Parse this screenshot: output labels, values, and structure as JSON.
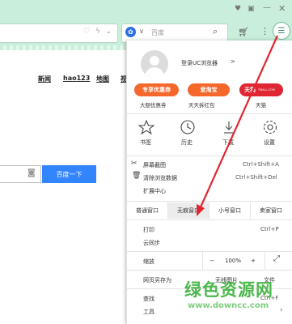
{
  "search": {
    "engine_name": "百度"
  },
  "page_nav": [
    "新闻",
    "hao123",
    "地图",
    "视"
  ],
  "baidu_button": "百度一下",
  "menu": {
    "login": "登录UC浏览器",
    "login_arrow": ">",
    "promos": [
      {
        "badge": "专享优惠券",
        "caption": "大额优惠券",
        "color": "#f5672a"
      },
      {
        "badge": "爱淘宝",
        "caption": "天天拆红包",
        "color": "#f5672a"
      },
      {
        "badge": "天猫",
        "caption": "天猫",
        "color": "#e02533"
      }
    ],
    "tmall_small": "TMALL.COM",
    "icons": [
      {
        "label": "书签"
      },
      {
        "label": "历史"
      },
      {
        "label": "下载"
      },
      {
        "label": "设置"
      }
    ],
    "screenshot": "屏幕截图",
    "screenshot_shortcut": "Ctrl+Shift+A",
    "clear_data": "清除浏览数据",
    "clear_shortcut": "Ctrl+Shift+Del",
    "extensions": "扩展中心",
    "window_tabs": [
      "普通窗口",
      "无痕窗口",
      "小号窗口",
      "卖家窗口"
    ],
    "print": "打印",
    "print_shortcut": "Ctrl+P",
    "cloud_sync": "云同步",
    "zoom_label": "缩放",
    "zoom_minus": "−",
    "zoom_value": "100%",
    "zoom_plus": "+",
    "save_page": "网页另存为",
    "no_images": "无线图片",
    "file": "文件",
    "find": "查找",
    "find_shortcut": "Ctrl+F",
    "tools": "工具"
  },
  "watermark": {
    "title": "绿色资源网",
    "url": "www.downcc.com"
  },
  "colors": {
    "theme": "#c9eedb",
    "arrow": "#e0262f",
    "baidu": "#3385ff"
  }
}
